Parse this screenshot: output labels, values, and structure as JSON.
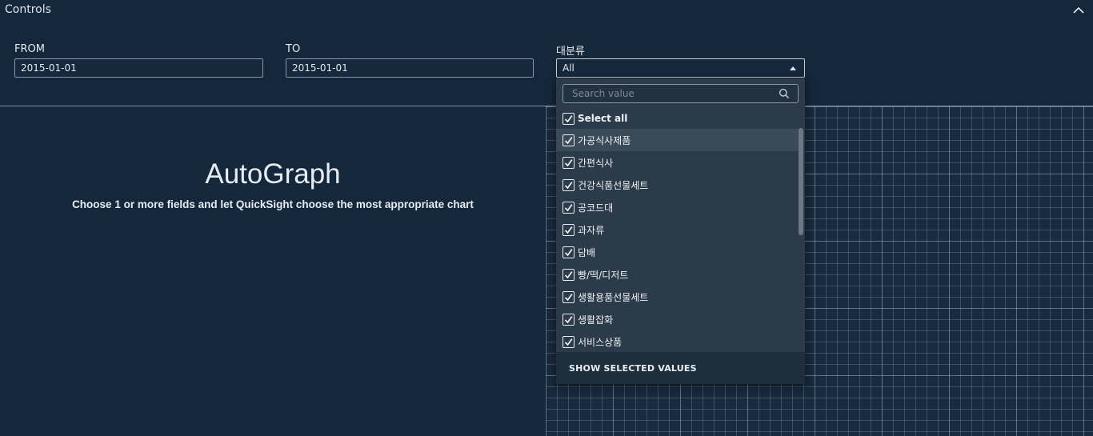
{
  "controls": {
    "title": "Controls",
    "from": {
      "label": "FROM",
      "value": "2015-01-01"
    },
    "to": {
      "label": "TO",
      "value": "2015-01-01"
    },
    "category": {
      "label": "대분류",
      "value": "All"
    }
  },
  "dropdown": {
    "search_placeholder": "Search value",
    "select_all_label": "Select all",
    "items": [
      {
        "label": "가공식사제품",
        "checked": true
      },
      {
        "label": "간편식사",
        "checked": true
      },
      {
        "label": "건강식품선물세트",
        "checked": true
      },
      {
        "label": "공코드대",
        "checked": true
      },
      {
        "label": "과자류",
        "checked": true
      },
      {
        "label": "담배",
        "checked": true
      },
      {
        "label": "빵/떡/디저트",
        "checked": true
      },
      {
        "label": "생활용품선물세트",
        "checked": true
      },
      {
        "label": "생활잡화",
        "checked": true
      },
      {
        "label": "서비스상품",
        "checked": true
      }
    ],
    "footer_label": "SHOW SELECTED VALUES"
  },
  "autograph": {
    "title": "AutoGraph",
    "subtitle": "Choose 1 or more fields and let QuickSight choose the most appropriate chart"
  }
}
